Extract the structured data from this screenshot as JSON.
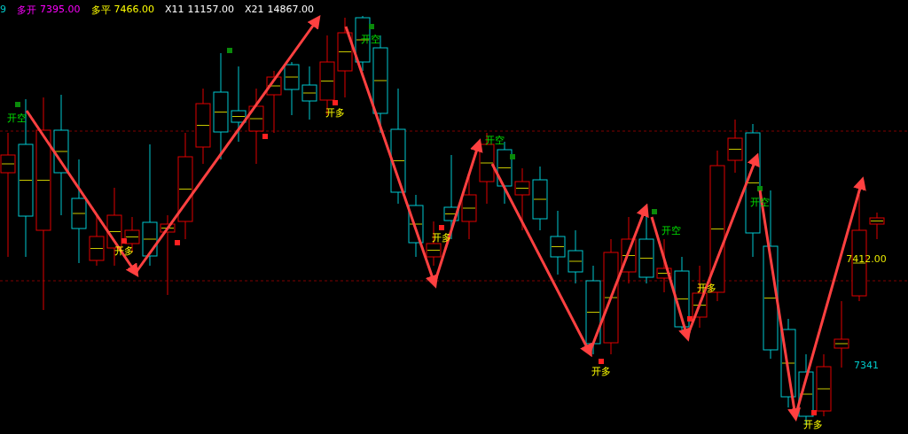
{
  "header": {
    "lead": "9",
    "items": [
      {
        "label": "多开",
        "value": "7395.00",
        "color": "#ff00ff"
      },
      {
        "label": "多平",
        "value": "7466.00",
        "color": "#ffff00"
      },
      {
        "label": "X11",
        "value": "11157.00",
        "color": "#ffffff"
      },
      {
        "label": "X21",
        "value": "14867.00",
        "color": "#ffffff"
      }
    ]
  },
  "signals": [
    {
      "kind": "short",
      "label": "开空"
    },
    {
      "kind": "long",
      "label": "开多"
    },
    {
      "kind": "long",
      "label": "开多"
    },
    {
      "kind": "short",
      "label": "开空"
    },
    {
      "kind": "long",
      "label": "开多"
    },
    {
      "kind": "short",
      "label": "开空"
    },
    {
      "kind": "long",
      "label": "开多"
    },
    {
      "kind": "short",
      "label": "开空"
    },
    {
      "kind": "long",
      "label": "开多"
    },
    {
      "kind": "short",
      "label": "开空"
    },
    {
      "kind": "long",
      "label": "开多"
    }
  ],
  "price_labels": [
    {
      "kind": "last",
      "text": "7412.00"
    },
    {
      "kind": "low",
      "text": "7341"
    }
  ]
}
